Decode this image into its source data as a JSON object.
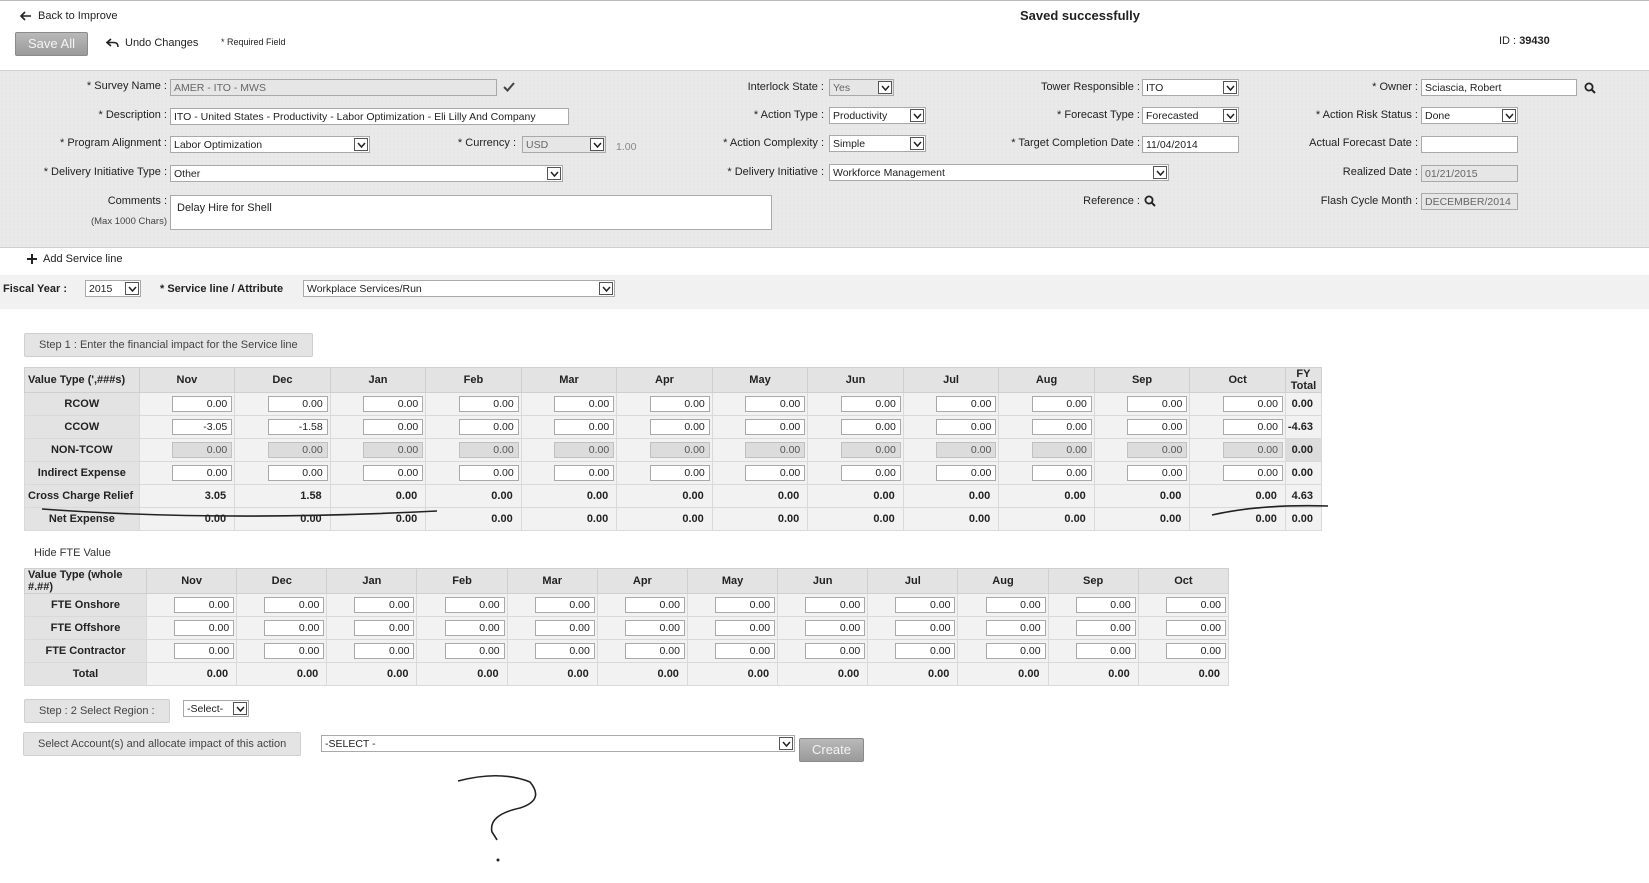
{
  "header": {
    "back_label": "Back to Improve",
    "saved_message": "Saved successfully",
    "save_all_label": "Save All",
    "undo_label": "Undo Changes",
    "required_note": "* Required Field",
    "id_label": "ID :",
    "id_value": "39430"
  },
  "form": {
    "survey_name_label": "* Survey Name :",
    "survey_name_value": "AMER - ITO - MWS",
    "description_label": "* Description :",
    "description_value": "ITO - United States - Productivity - Labor Optimization - Eli Lilly And Company",
    "program_alignment_label": "* Program Alignment :",
    "program_alignment_value": "Labor Optimization",
    "currency_label": "* Currency :",
    "currency_value": "USD",
    "currency_rate": "1.00",
    "delivery_initiative_type_label": "* Delivery Initiative Type :",
    "delivery_initiative_type_value": "Other",
    "comments_label": "Comments :",
    "comments_hint": "(Max 1000 Chars)",
    "comments_value": "Delay Hire for Shell",
    "interlock_state_label": "Interlock State :",
    "interlock_state_value": "Yes",
    "action_type_label": "* Action Type :",
    "action_type_value": "Productivity",
    "action_complexity_label": "* Action Complexity :",
    "action_complexity_value": "Simple",
    "delivery_initiative_label": "* Delivery Initiative :",
    "delivery_initiative_value": "Workforce Management",
    "tower_responsible_label": "Tower Responsible :",
    "tower_responsible_value": "ITO",
    "forecast_type_label": "* Forecast Type :",
    "forecast_type_value": "Forecasted",
    "target_completion_label": "* Target Completion Date :",
    "target_completion_value": "11/04/2014",
    "reference_label": "Reference :",
    "owner_label": "* Owner :",
    "owner_value": "Sciascia, Robert",
    "action_risk_label": "* Action Risk Status :",
    "action_risk_value": "Done",
    "actual_forecast_label": "Actual Forecast Date :",
    "actual_forecast_value": "",
    "realized_date_label": "Realized Date :",
    "realized_date_value": "01/21/2015",
    "flash_cycle_label": "Flash Cycle Month :",
    "flash_cycle_value": "DECEMBER/2014"
  },
  "service_line": {
    "add_label": "Add Service line",
    "fiscal_year_label": "Fiscal Year :",
    "fiscal_year_value": "2015",
    "service_line_label": "* Service line / Attribute",
    "service_line_value": "Workplace Services/Run"
  },
  "step1": {
    "label": "Step 1 : Enter the financial impact for the Service line",
    "header_first": "Value Type (',###s)",
    "months": [
      "Nov",
      "Dec",
      "Jan",
      "Feb",
      "Mar",
      "Apr",
      "May",
      "Jun",
      "Jul",
      "Aug",
      "Sep",
      "Oct"
    ],
    "total_header": "FY Total",
    "rows": [
      {
        "label": "RCOW",
        "values": [
          "0.00",
          "0.00",
          "0.00",
          "0.00",
          "0.00",
          "0.00",
          "0.00",
          "0.00",
          "0.00",
          "0.00",
          "0.00",
          "0.00"
        ],
        "total": "0.00"
      },
      {
        "label": "CCOW",
        "values": [
          "-3.05",
          "-1.58",
          "0.00",
          "0.00",
          "0.00",
          "0.00",
          "0.00",
          "0.00",
          "0.00",
          "0.00",
          "0.00",
          "0.00"
        ],
        "total": "-4.63"
      },
      {
        "label": "NON-TCOW",
        "values": [
          "0.00",
          "0.00",
          "0.00",
          "0.00",
          "0.00",
          "0.00",
          "0.00",
          "0.00",
          "0.00",
          "0.00",
          "0.00",
          "0.00"
        ],
        "total": "0.00"
      },
      {
        "label": "Indirect Expense",
        "values": [
          "0.00",
          "0.00",
          "0.00",
          "0.00",
          "0.00",
          "0.00",
          "0.00",
          "0.00",
          "0.00",
          "0.00",
          "0.00",
          "0.00"
        ],
        "total": "0.00"
      },
      {
        "label": "Cross Charge Relief",
        "values": [
          "3.05",
          "1.58",
          "0.00",
          "0.00",
          "0.00",
          "0.00",
          "0.00",
          "0.00",
          "0.00",
          "0.00",
          "0.00",
          "0.00"
        ],
        "total": "4.63"
      },
      {
        "label": "Net Expense",
        "values": [
          "0.00",
          "0.00",
          "0.00",
          "0.00",
          "0.00",
          "0.00",
          "0.00",
          "0.00",
          "0.00",
          "0.00",
          "0.00",
          "0.00"
        ],
        "total": "0.00"
      }
    ]
  },
  "fte": {
    "hide_label": "Hide FTE Value",
    "header_first": "Value Type (whole #.##)",
    "months": [
      "Nov",
      "Dec",
      "Jan",
      "Feb",
      "Mar",
      "Apr",
      "May",
      "Jun",
      "Jul",
      "Aug",
      "Sep",
      "Oct"
    ],
    "rows": [
      {
        "label": "FTE Onshore",
        "values": [
          "0.00",
          "0.00",
          "0.00",
          "0.00",
          "0.00",
          "0.00",
          "0.00",
          "0.00",
          "0.00",
          "0.00",
          "0.00",
          "0.00"
        ]
      },
      {
        "label": "FTE Offshore",
        "values": [
          "0.00",
          "0.00",
          "0.00",
          "0.00",
          "0.00",
          "0.00",
          "0.00",
          "0.00",
          "0.00",
          "0.00",
          "0.00",
          "0.00"
        ]
      },
      {
        "label": "FTE Contractor",
        "values": [
          "0.00",
          "0.00",
          "0.00",
          "0.00",
          "0.00",
          "0.00",
          "0.00",
          "0.00",
          "0.00",
          "0.00",
          "0.00",
          "0.00"
        ]
      },
      {
        "label": "Total",
        "values": [
          "0.00",
          "0.00",
          "0.00",
          "0.00",
          "0.00",
          "0.00",
          "0.00",
          "0.00",
          "0.00",
          "0.00",
          "0.00",
          "0.00"
        ]
      }
    ]
  },
  "step2": {
    "label": "Step : 2 Select Region :",
    "region_value": "-Select-",
    "accounts_label": "Select Account(s) and allocate impact of this action",
    "accounts_value": "-SELECT -",
    "create_label": "Create"
  }
}
